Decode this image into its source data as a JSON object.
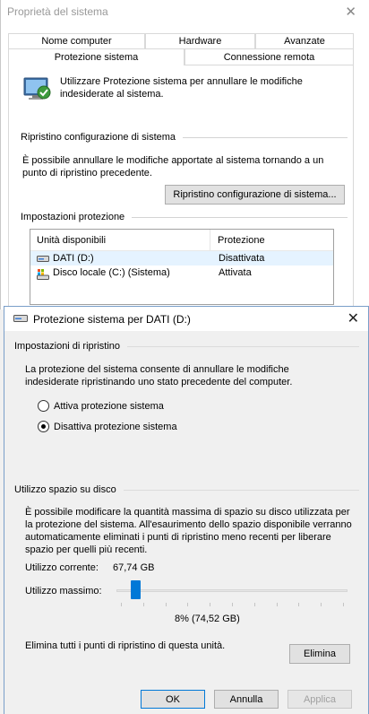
{
  "back_window": {
    "title": "Proprietà del sistema",
    "tabs_row1": [
      "Nome computer",
      "Hardware",
      "Avanzate"
    ],
    "tabs_row2": [
      "Protezione sistema",
      "Connessione remota"
    ],
    "intro_text": "Utilizzare Protezione sistema per annullare le modifiche indesiderate al sistema.",
    "restore_heading": "Ripristino configurazione di sistema",
    "restore_text": "È possibile annullare le modifiche apportate al sistema tornando a un punto di ripristino precedente.",
    "restore_button": "Ripristino configurazione di sistema...",
    "settings_heading": "Impostazioni protezione",
    "list_headers": [
      "Unità disponibili",
      "Protezione"
    ],
    "drives": [
      {
        "name": "DATI (D:)",
        "status": "Disattivata"
      },
      {
        "name": "Disco locale (C:) (Sistema)",
        "status": "Attivata"
      }
    ]
  },
  "dialog": {
    "title": "Protezione sistema per DATI (D:)",
    "restore_settings_label": "Impostazioni di ripristino",
    "restore_settings_text": "La protezione del sistema consente di annullare le modifiche indesiderate ripristinando uno stato precedente del computer.",
    "radio_on": "Attiva protezione sistema",
    "radio_off": "Disattiva protezione sistema",
    "selected_option": "Disattiva protezione sistema",
    "disk_usage_label": "Utilizzo spazio su disco",
    "disk_usage_text": "È possibile modificare la quantità massima di spazio su disco utilizzata per la protezione del sistema. All'esaurimento dello spazio disponibile verranno automaticamente eliminati i punti di ripristino meno recenti per liberare spazio per quelli più recenti.",
    "current_usage_label": "Utilizzo corrente:",
    "current_usage_value": "67,74 GB",
    "max_usage_label": "Utilizzo massimo:",
    "slider_percent": 8,
    "max_usage_value": "8% (74,52 GB)",
    "delete_text": "Elimina tutti i punti di ripristino di questa unità.",
    "delete_button": "Elimina",
    "ok_button": "OK",
    "cancel_button": "Annulla",
    "apply_button": "Applica",
    "accent_color": "#0078d7"
  }
}
